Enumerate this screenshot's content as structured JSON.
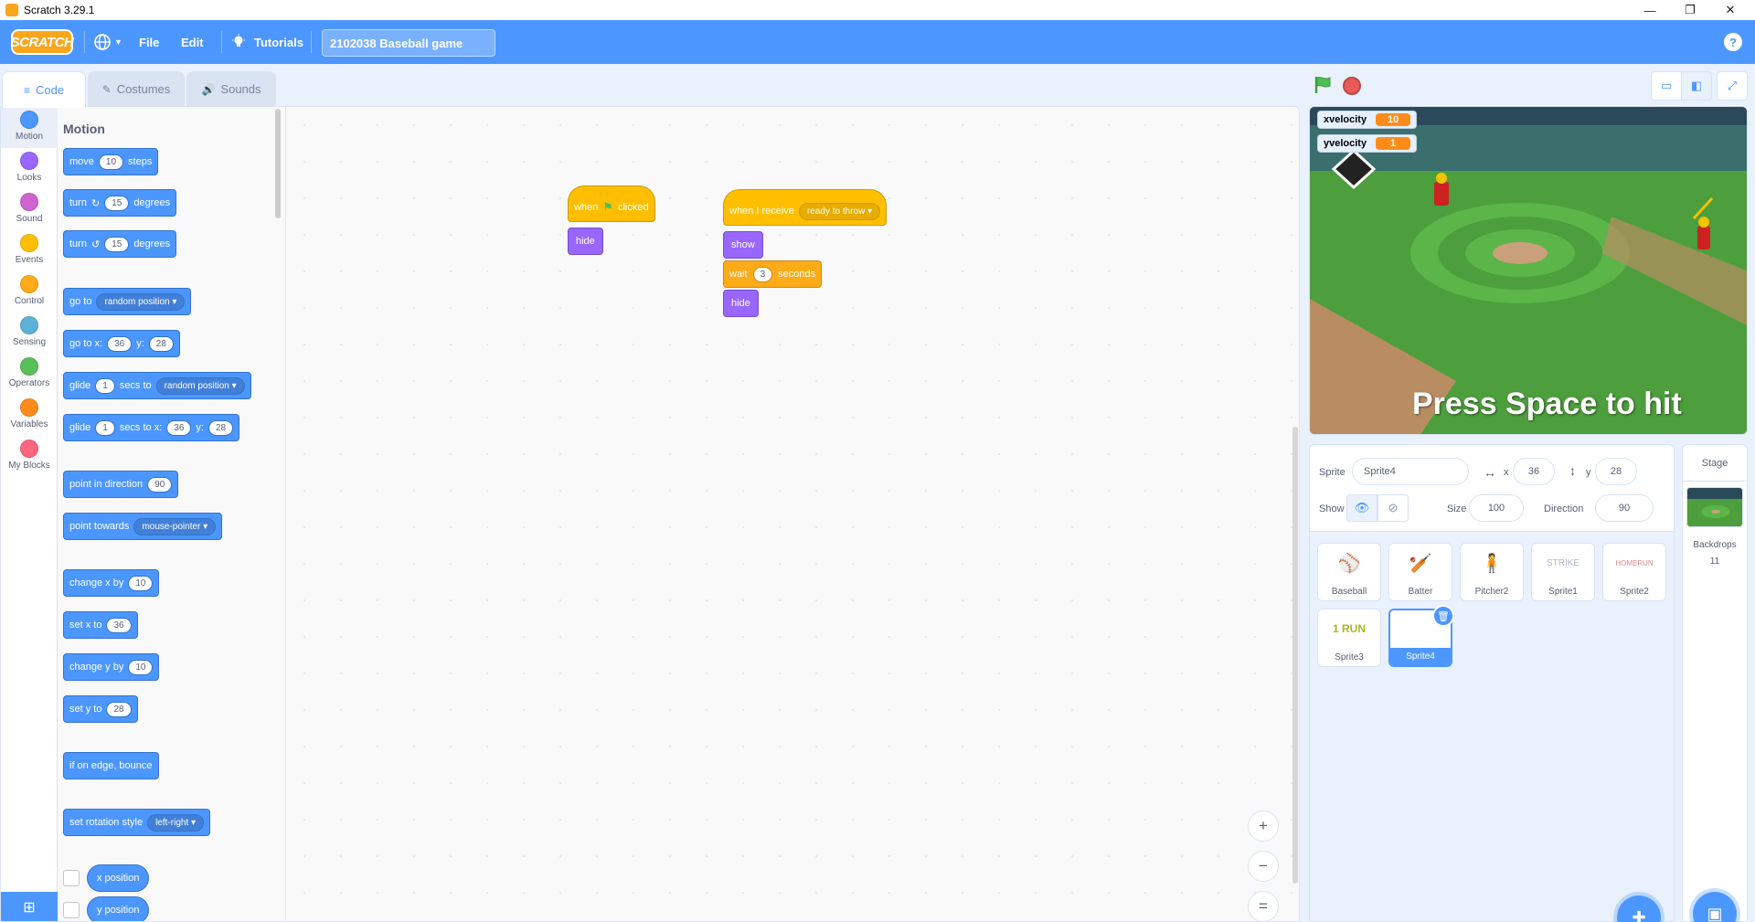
{
  "window": {
    "title": "Scratch 3.29.1",
    "minimize": "—",
    "maximize": "❐",
    "close": "✕"
  },
  "menubar": {
    "logo": "SCRATCH",
    "language_icon": "globe-icon",
    "file": "File",
    "edit": "Edit",
    "tutorials": "Tutorials",
    "project_title": "2102038 Baseball game",
    "help": "?"
  },
  "tabs": [
    {
      "label": "Code",
      "active": true
    },
    {
      "label": "Costumes",
      "active": false
    },
    {
      "label": "Sounds",
      "active": false
    }
  ],
  "categories": [
    {
      "label": "Motion",
      "color": "#4c97ff"
    },
    {
      "label": "Looks",
      "color": "#9966ff"
    },
    {
      "label": "Sound",
      "color": "#cf63cf"
    },
    {
      "label": "Events",
      "color": "#ffbf00"
    },
    {
      "label": "Control",
      "color": "#ffab19"
    },
    {
      "label": "Sensing",
      "color": "#5cb1d6"
    },
    {
      "label": "Operators",
      "color": "#59c059"
    },
    {
      "label": "Variables",
      "color": "#ff8c1a"
    },
    {
      "label": "My Blocks",
      "color": "#ff6680"
    }
  ],
  "palette": {
    "title": "Motion",
    "move": {
      "a": "move",
      "v": "10",
      "b": "steps"
    },
    "turn_cw": {
      "a": "turn",
      "v": "15",
      "b": "degrees"
    },
    "turn_ccw": {
      "a": "turn",
      "v": "15",
      "b": "degrees"
    },
    "goto": {
      "a": "go to",
      "d": "random position"
    },
    "gotoxy": {
      "a": "go to x:",
      "x": "36",
      "b": "y:",
      "y": "28"
    },
    "glide": {
      "a": "glide",
      "v": "1",
      "b": "secs to",
      "d": "random position"
    },
    "glidexy": {
      "a": "glide",
      "v": "1",
      "b": "secs to x:",
      "x": "36",
      "c": "y:",
      "y": "28"
    },
    "point_dir": {
      "a": "point in direction",
      "v": "90"
    },
    "point_towards": {
      "a": "point towards",
      "d": "mouse-pointer"
    },
    "change_x": {
      "a": "change x by",
      "v": "10"
    },
    "set_x": {
      "a": "set x to",
      "v": "36"
    },
    "change_y": {
      "a": "change y by",
      "v": "10"
    },
    "set_y": {
      "a": "set y to",
      "v": "28"
    },
    "bounce": "if on edge, bounce",
    "rotation": {
      "a": "set rotation style",
      "d": "left-right"
    },
    "x_position": "x position",
    "y_position": "y position"
  },
  "scripts": {
    "s1": {
      "when": "when",
      "clicked": "clicked",
      "hide": "hide"
    },
    "s2": {
      "when_receive": "when I receive",
      "message": "ready to throw",
      "show": "show",
      "wait": "wait",
      "wait_val": "3",
      "seconds": "seconds",
      "hide": "hide"
    }
  },
  "zoom": {
    "in": "+",
    "out": "−",
    "reset": "="
  },
  "stage": {
    "monitors": [
      {
        "label": "xvelocity",
        "value": "10"
      },
      {
        "label": "yvelocity",
        "value": "1"
      }
    ],
    "message": "Press Space to hit"
  },
  "sprite_info": {
    "sprite_label": "Sprite",
    "sprite_name": "Sprite4",
    "x_label": "x",
    "x": "36",
    "y_label": "y",
    "y": "28",
    "show_label": "Show",
    "size_label": "Size",
    "size": "100",
    "direction_label": "Direction",
    "direction": "90"
  },
  "sprites": [
    {
      "name": "Baseball",
      "thumb": "⚾"
    },
    {
      "name": "Batter",
      "thumb": "🏏"
    },
    {
      "name": "Pitcher2",
      "thumb": "🧍"
    },
    {
      "name": "Sprite1",
      "thumb": "STRIKE"
    },
    {
      "name": "Sprite2",
      "thumb": "HOMERUN"
    },
    {
      "name": "Sprite3",
      "thumb": "1 RUN"
    },
    {
      "name": "Sprite4",
      "thumb": "",
      "selected": true
    }
  ],
  "stage_panel": {
    "title": "Stage",
    "backdrops_label": "Backdrops",
    "backdrops_count": "11"
  }
}
